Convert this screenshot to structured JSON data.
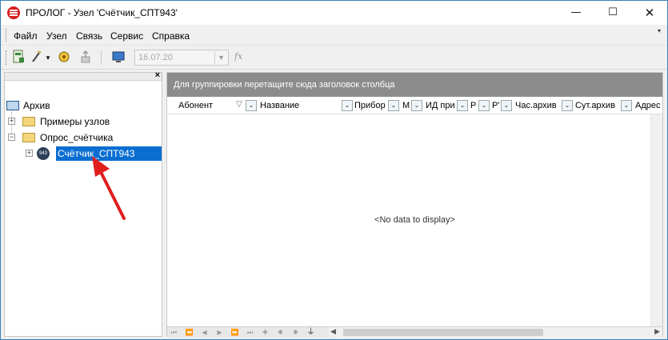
{
  "window": {
    "title": "ПРОЛОГ - Узел 'Счётчик_СПТ943'",
    "min_glyph": "—",
    "max_glyph": "☐",
    "close_glyph": "✕"
  },
  "menu": {
    "items": [
      "Файл",
      "Узел",
      "Связь",
      "Сервис",
      "Справка"
    ],
    "overflow_glyph": "▾"
  },
  "toolbar": {
    "date_value": "16.07.20",
    "date_drop_glyph": "▼",
    "fx_label": "fx",
    "dropdown_glyph": "▾",
    "icons": [
      "connect-icon",
      "wand-icon",
      "settings-icon",
      "upload-icon",
      "monitor-icon"
    ]
  },
  "tree": {
    "close_glyph": "×",
    "expand_glyph": "+",
    "collapse_glyph": "−",
    "root": "Архив",
    "items": [
      {
        "label": "Примеры узлов"
      },
      {
        "label": "Опрос_счётчика"
      },
      {
        "label": "Счётчик_СПТ943",
        "badge": "943",
        "selected": true
      }
    ]
  },
  "grid": {
    "group_hint": "Для группировки перетащите сюда заголовок столбца",
    "sort_glyph": "▽",
    "filter_glyph": "⌄",
    "columns": [
      "Абонент",
      "Название",
      "Прибор",
      "М",
      "ИД при",
      "Р",
      "Р'",
      "Час.архив",
      "Сут.архив",
      "Адрес"
    ],
    "empty_text": "<No data to display>",
    "nav_glyphs": [
      "⏮",
      "⏪",
      "◀",
      "▶",
      "⏩",
      "⏭",
      "✚",
      "✱",
      "✱",
      "⏚"
    ],
    "scroll_left": "◀",
    "scroll_right": "▶"
  },
  "colors": {
    "selection": "#0a6ed1",
    "group_bar": "#8c8c8c",
    "arrow": "#e01e1e"
  }
}
